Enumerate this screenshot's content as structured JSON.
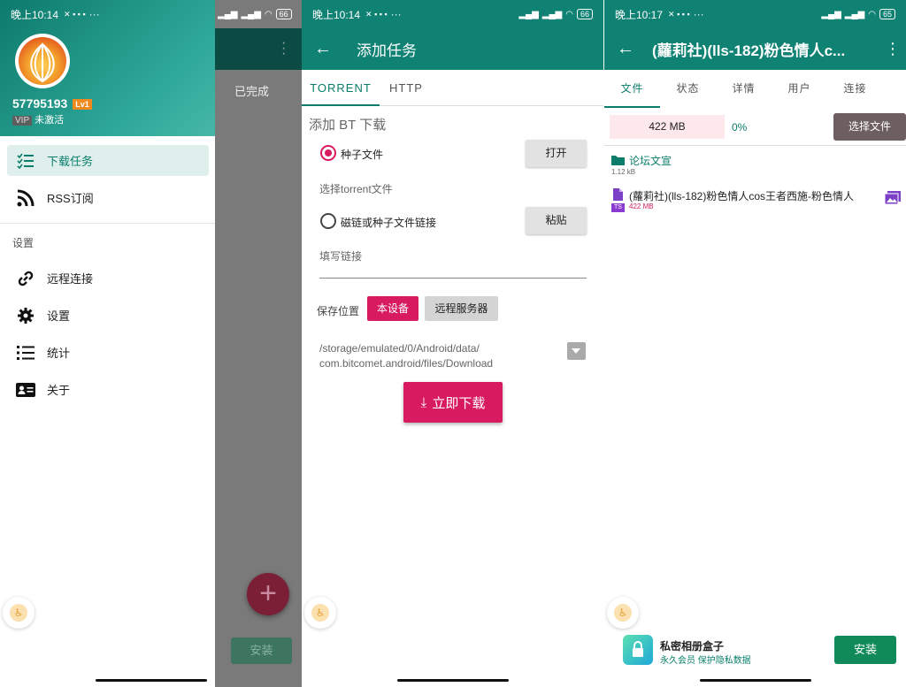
{
  "panel1": {
    "status": {
      "time": "晚上10:14",
      "dots": "···",
      "battery": "66"
    },
    "user": {
      "id": "57795193",
      "level": "Lv1",
      "vip": "VIP",
      "vip_status": "未激活"
    },
    "menu": [
      {
        "label": "下载任务",
        "icon": "checklist-icon",
        "active": true
      },
      {
        "label": "RSS订阅",
        "icon": "rss-icon",
        "active": false
      }
    ],
    "section_label": "设置",
    "settings_menu": [
      {
        "label": "远程连接",
        "icon": "link-icon"
      },
      {
        "label": "设置",
        "icon": "gear-icon"
      },
      {
        "label": "统计",
        "icon": "list-icon"
      },
      {
        "label": "关于",
        "icon": "id-card-icon"
      }
    ],
    "behind": {
      "done_label": "已完成",
      "install_label": "安装",
      "fab_symbol": "+"
    }
  },
  "panel2": {
    "status": {
      "time": "晚上10:14",
      "dots": "···",
      "battery": "66"
    },
    "title": "添加任务",
    "tabs": [
      "TORRENT",
      "HTTP"
    ],
    "bt_title": "添加 BT 下载",
    "torrent_file_label": "种子文件",
    "open_button": "打开",
    "torrent_hint": "选择torrent文件",
    "magnet_label": "磁链或种子文件链接",
    "paste_button": "粘贴",
    "link_placeholder": "填写链接",
    "save_location_label": "保存位置",
    "device_button": "本设备",
    "remote_button": "远程服务器",
    "path_line1": "/storage/emulated/0/Android/data/",
    "path_line2": "com.bitcomet.android/files/Download",
    "download_button": "立即下载"
  },
  "panel3": {
    "status": {
      "time": "晚上10:17",
      "dots": "···",
      "battery": "65"
    },
    "title": "(蘿莉社)(lls-182)粉色情人c...",
    "tabs": [
      "文件",
      "状态",
      "详情",
      "用户",
      "连接"
    ],
    "size": "422 MB",
    "progress": "0%",
    "select_button": "选择文件",
    "folder": {
      "name": "论坛文宣",
      "size": "1.12 kB"
    },
    "file": {
      "name": "(蘿莉社)(lls-182)粉色情人cos王者西施-粉色情人",
      "badge": "TS",
      "size": "422 MB"
    },
    "ad": {
      "title": "私密相册盒子",
      "subtitle": "永久会员   保护隐私数据",
      "button": "安装"
    }
  },
  "colors": {
    "teal": "#0f8274",
    "pink": "#d81b60",
    "accent_text": "#0a7d6b"
  }
}
